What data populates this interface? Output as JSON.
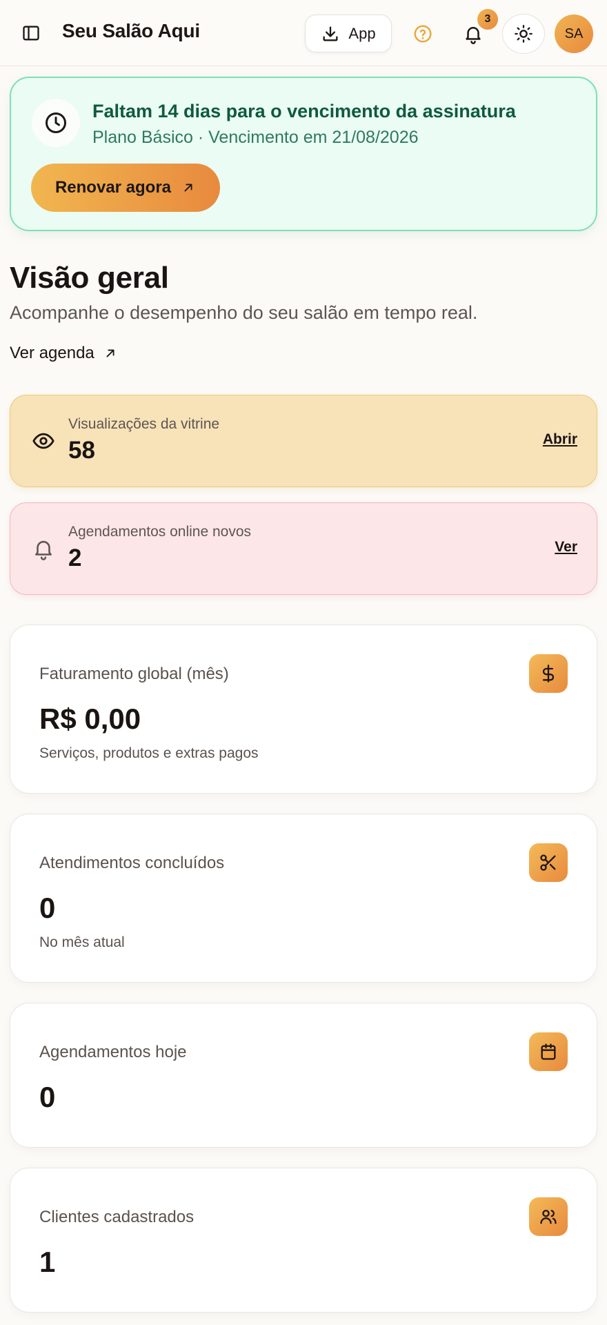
{
  "header": {
    "title": "Seu Salão Aqui",
    "app_button_label": "App",
    "notification_count": "3",
    "avatar_initials": "SA"
  },
  "subscription_banner": {
    "title": "Faltam 14 dias para o vencimento da assinatura",
    "subtitle": "Plano Básico · Vencimento em 21/08/2026",
    "renew_button_label": "Renovar agora"
  },
  "overview": {
    "title": "Visão geral",
    "subtitle": "Acompanhe o desempenho do seu salão em tempo real.",
    "agenda_link": "Ver agenda"
  },
  "alerts": [
    {
      "label": "Visualizações da vitrine",
      "value": "58",
      "action": "Abrir",
      "icon": "eye-icon"
    },
    {
      "label": "Agendamentos online novos",
      "value": "2",
      "action": "Ver",
      "icon": "bell-icon"
    }
  ],
  "stats": [
    {
      "label": "Faturamento global (mês)",
      "value": "R$ 0,00",
      "note": "Serviços, produtos e extras pagos",
      "icon": "dollar-icon"
    },
    {
      "label": "Atendimentos concluídos",
      "value": "0",
      "note": "No mês atual",
      "icon": "scissors-icon"
    },
    {
      "label": "Agendamentos hoje",
      "value": "0",
      "note": "",
      "icon": "calendar-icon"
    },
    {
      "label": "Clientes cadastrados",
      "value": "1",
      "note": "",
      "icon": "users-icon"
    }
  ],
  "colors": {
    "accent": "#e88a3e",
    "accent_light": "#f1b650",
    "banner_bg": "#eafcf4",
    "banner_text": "#0f5a3e",
    "views_card_bg": "#f8e2b8",
    "bookings_card_bg": "#fde6e7"
  }
}
